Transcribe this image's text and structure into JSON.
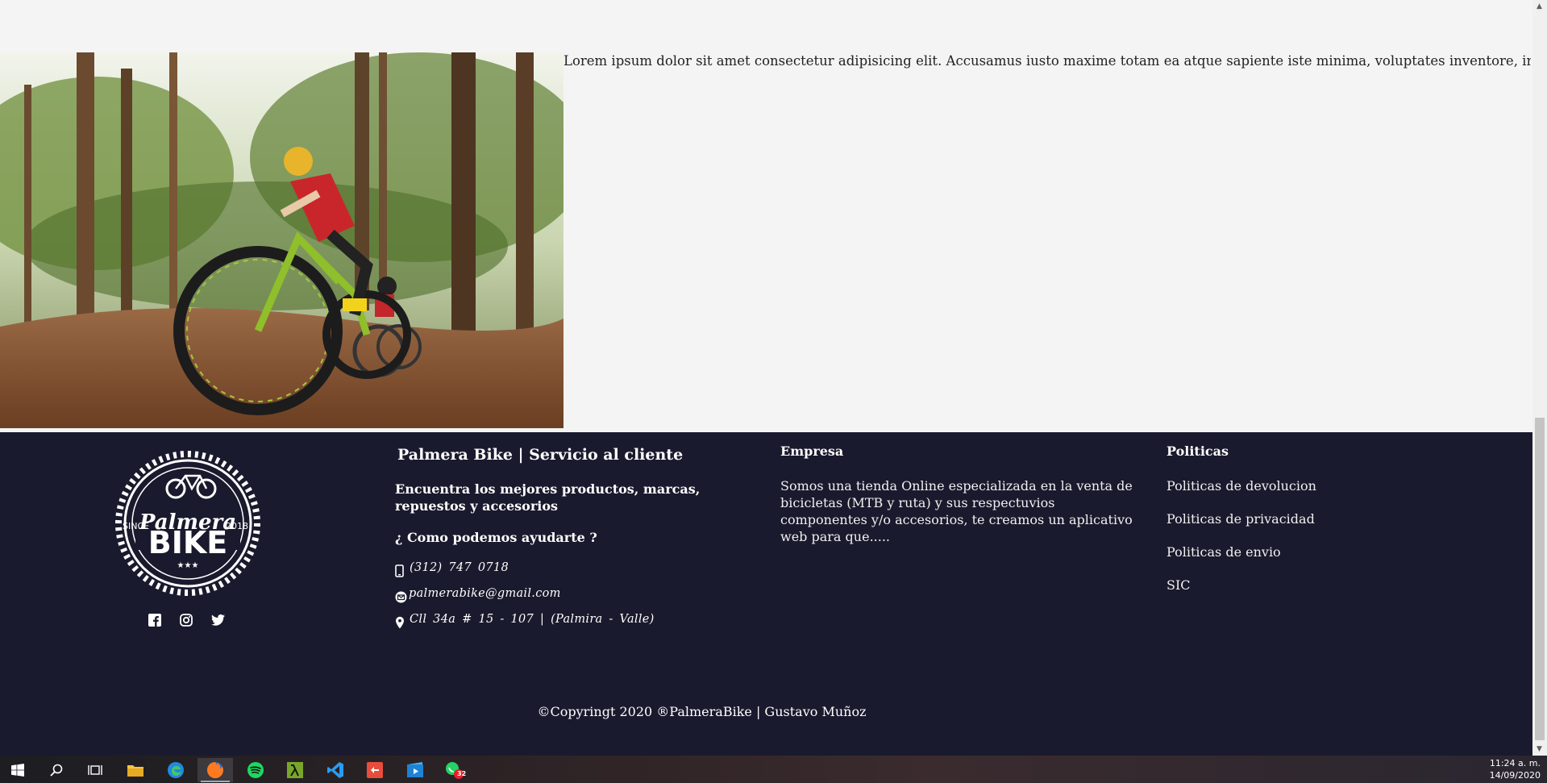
{
  "main": {
    "paragraph": "Lorem ipsum dolor sit amet consectetur adipisicing elit. Accusamus iusto maxime totam ea atque sapiente iste minima, voluptates inventore, impedit sed illum dolore,"
  },
  "footer": {
    "logo": {
      "top": "Palmera",
      "bottom": "BIKE",
      "left": "SINCE",
      "right": "2018"
    },
    "social": [
      "facebook-icon",
      "instagram-icon",
      "twitter-icon"
    ],
    "col1": {
      "title": "Palmera Bike | Servicio al cliente",
      "tagline": "Encuentra los mejores productos, marcas, repuestos y accesorios",
      "ask": "¿ Como podemos ayudarte ?",
      "phone": "(312)  747  0718",
      "email": "palmerabike@gmail.com",
      "address": "Cll  34a  #  15  -  107  |  (Palmira  -  Valle)"
    },
    "col2": {
      "title": "Empresa",
      "text": "Somos una tienda Online especializada en la venta de bicicletas (MTB y ruta) y sus respectuvios componentes y/o accesorios, te creamos un aplicativo web para que....."
    },
    "col3": {
      "title": "Politicas",
      "links": [
        "Politicas de devolucion",
        "Politicas de privacidad",
        "Politicas de envio",
        "SIC"
      ]
    },
    "copyright": "©Copyringt 2020 ®PalmeraBike | Gustavo Muñoz"
  },
  "taskbar": {
    "time": "11:24 a. m.",
    "date": "14/09/2020",
    "badge": "32",
    "apps": [
      "windows-start-icon",
      "search-icon",
      "task-view-icon",
      "file-explorer-icon",
      "edge-icon",
      "firefox-icon",
      "spotify-icon",
      "lambda-app-icon",
      "vscode-icon",
      "git-icon",
      "video-app-icon",
      "whatsapp-icon"
    ]
  },
  "colors": {
    "footer_bg": "#1a1a2e",
    "page_bg": "#f4f4f4"
  }
}
